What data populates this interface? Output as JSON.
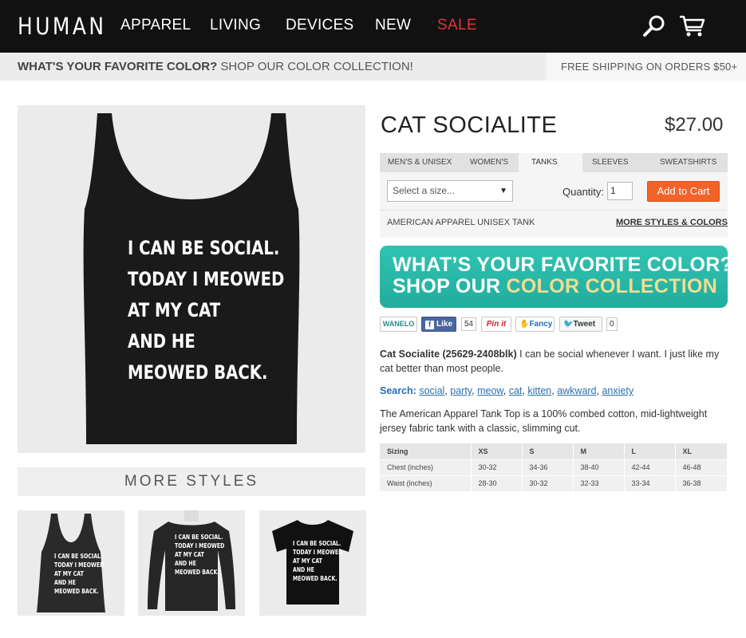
{
  "header": {
    "logo": "HUMAN",
    "nav": [
      "APPAREL",
      "LIVING",
      "DEVICES",
      "NEW",
      "SALE"
    ],
    "sale_color": "#e2333b"
  },
  "promo": {
    "question": "WHAT'S YOUR FAVORITE COLOR?",
    "shop": " SHOP OUR COLOR COLLECTION!",
    "shipping": "FREE SHIPPING ON ORDERS $50+"
  },
  "product": {
    "shirt_text": [
      "I CAN BE SOCIAL.",
      "TODAY I MEOWED",
      "AT MY CAT",
      "AND HE",
      "MEOWED BACK."
    ],
    "title": "CAT SOCIALITE",
    "price": "$27.00",
    "tabs": [
      "MEN'S & UNISEX",
      "WOMEN'S",
      "TANKS",
      "SLEEVES",
      "SWEATSHIRTS"
    ],
    "active_tab": "TANKS",
    "size_placeholder": "Select a size...",
    "quantity_label": "Quantity:",
    "quantity": "1",
    "add_to_cart": "Add to Cart",
    "variant": "AMERICAN APPAREL UNISEX TANK",
    "more_styles_link": "MORE STYLES & COLORS"
  },
  "banner": {
    "line1": "WHAT’S YOUR FAVORITE COLOR?",
    "line2_a": "SHOP OUR ",
    "line2_b": "COLOR COLLECTION"
  },
  "social": {
    "wanelo": "WANELO",
    "like": "Like",
    "like_count": "54",
    "pinit": "Pin it",
    "fancy": "Fancy",
    "tweet": "Tweet",
    "tweet_count": "0"
  },
  "description": {
    "name": "Cat Socialite (25629-2408blk)",
    "text": " I can be social whenever I want. I just like my cat better than most people.",
    "search_label": "Search:",
    "tags": [
      "social",
      "party",
      "meow",
      "cat",
      "kitten",
      "awkward",
      "anxiety"
    ],
    "fabric": "The American Apparel Tank Top is a 100% combed cotton, mid-lightweight jersey fabric tank with a classic, slimming cut."
  },
  "sizing": {
    "headers": [
      "Sizing",
      "XS",
      "S",
      "M",
      "L",
      "XL"
    ],
    "rows": [
      [
        "Chest (inches)",
        "30-32",
        "34-36",
        "38-40",
        "42-44",
        "46-48"
      ],
      [
        "Waist (inches)",
        "28-30",
        "30-32",
        "32-33",
        "33-34",
        "36-38"
      ]
    ]
  },
  "more_styles": {
    "title": "MORE STYLES"
  }
}
